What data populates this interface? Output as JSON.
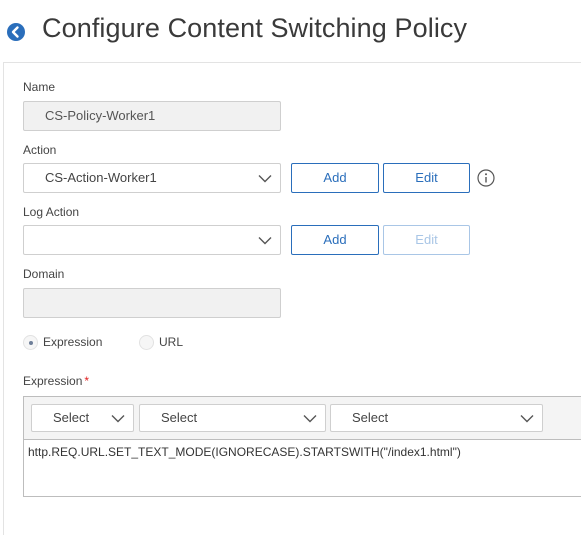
{
  "page": {
    "title": "Configure Content Switching Policy"
  },
  "name": {
    "label": "Name",
    "value": "CS-Policy-Worker1"
  },
  "action": {
    "label": "Action",
    "selected": "CS-Action-Worker1",
    "add_label": "Add",
    "edit_label": "Edit"
  },
  "log_action": {
    "label": "Log Action",
    "selected": "",
    "add_label": "Add",
    "edit_label": "Edit"
  },
  "domain": {
    "label": "Domain",
    "value": ""
  },
  "mode": {
    "options": [
      {
        "label": "Expression",
        "selected": true
      },
      {
        "label": "URL",
        "selected": false
      }
    ]
  },
  "expression": {
    "label": "Expression",
    "required_marker": "*",
    "selects": [
      "Select",
      "Select",
      "Select"
    ],
    "value": "http.REQ.URL.SET_TEXT_MODE(IGNORECASE).STARTSWITH(\"/index1.html\")"
  },
  "colors": {
    "accent": "#2a6ebb",
    "required": "#e02020"
  }
}
